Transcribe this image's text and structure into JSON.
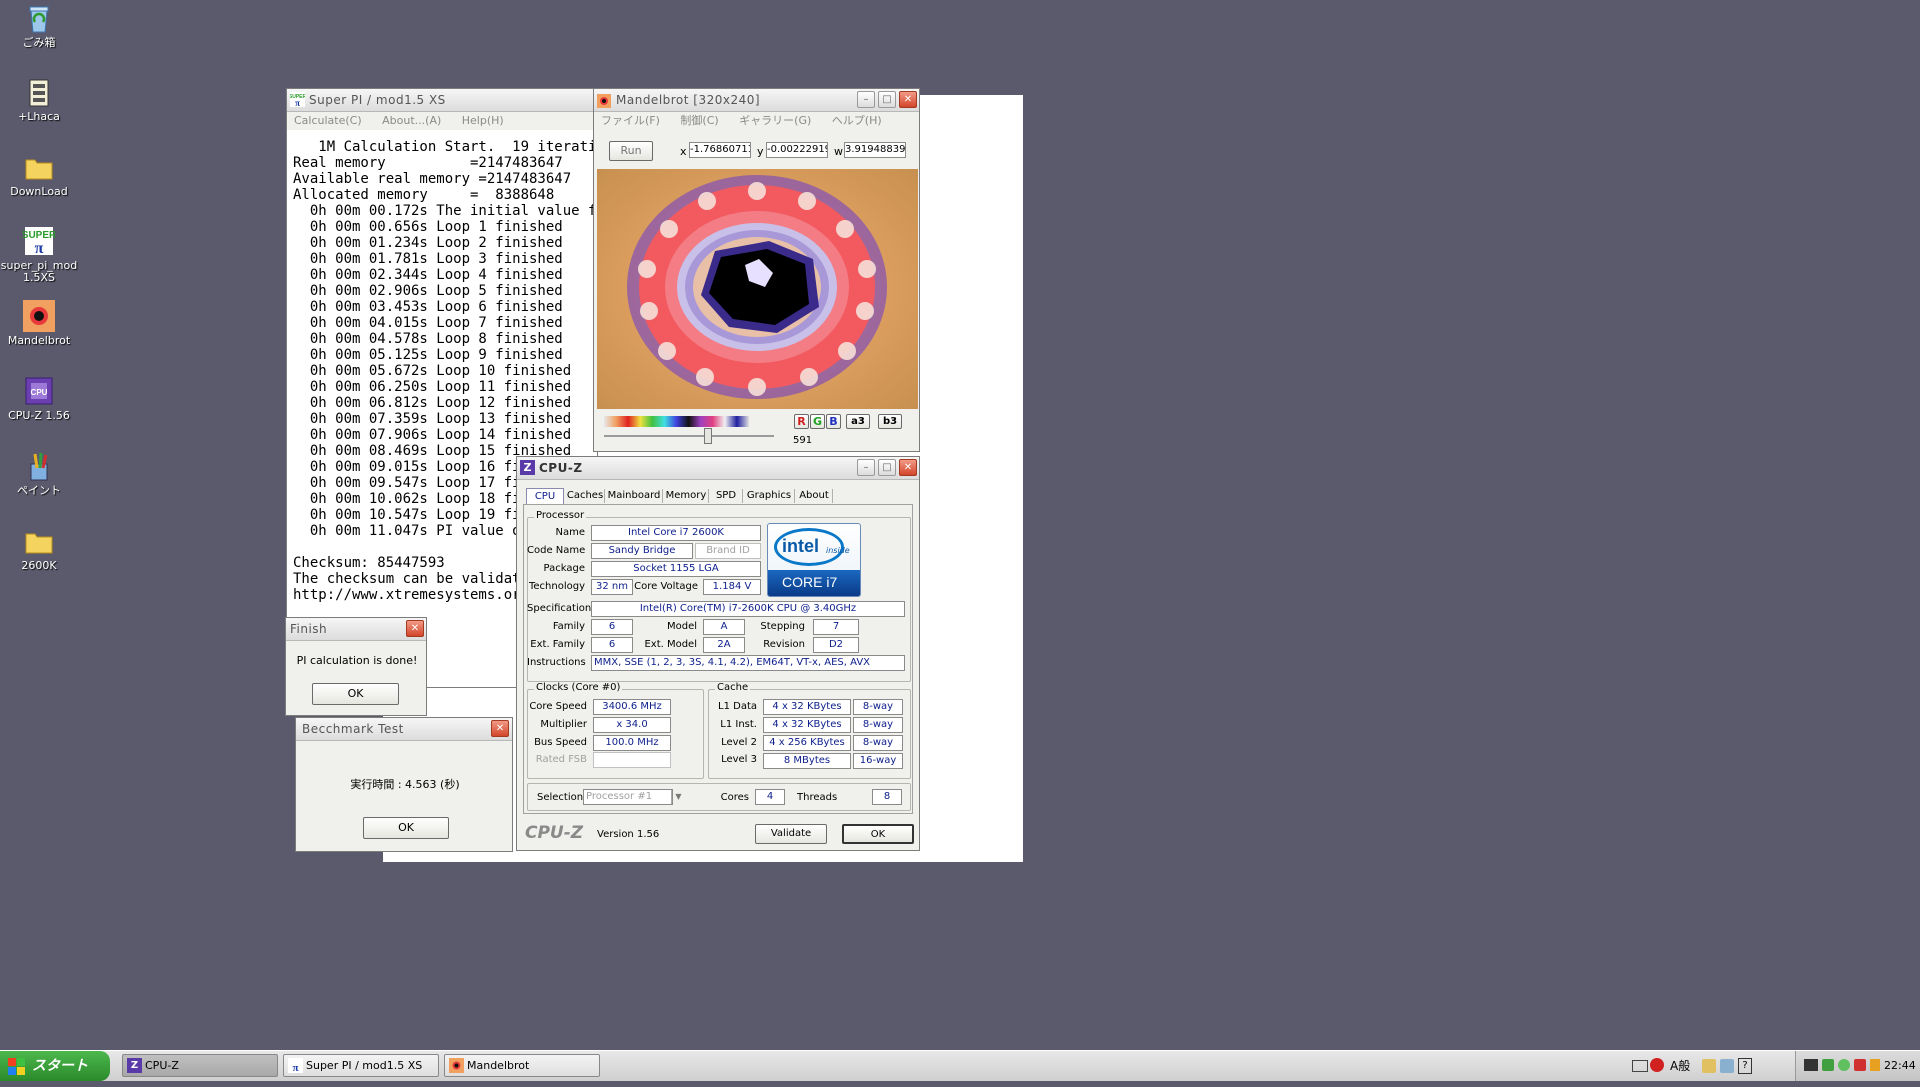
{
  "desktop": {
    "icons": [
      {
        "label": "ごみ箱",
        "name": "recycle-bin-icon"
      },
      {
        "label": "+Lhaca",
        "name": "lhaca-icon"
      },
      {
        "label": "DownLoad",
        "name": "folder-icon"
      },
      {
        "label": "super_pi_mod 1.5XS",
        "name": "superpi-app-icon"
      },
      {
        "label": "Mandelbrot",
        "name": "mandelbrot-app-icon"
      },
      {
        "label": "CPU-Z 1.56",
        "name": "cpuz-app-icon"
      },
      {
        "label": "ペイント",
        "name": "paint-app-icon"
      },
      {
        "label": "2600K",
        "name": "folder-icon"
      }
    ]
  },
  "superpi": {
    "title": "Super PI / mod1.5 XS",
    "menu": [
      "Calculate(C)",
      "About...(A)",
      "Help(H)"
    ],
    "log": [
      "   1M Calculation Start.  19 iterations.",
      "Real memory          =2147483647",
      "Available real memory =2147483647",
      "Allocated memory     =  8388648",
      "  0h 00m 00.172s The initial value finished",
      "  0h 00m 00.656s Loop 1 finished",
      "  0h 00m 01.234s Loop 2 finished",
      "  0h 00m 01.781s Loop 3 finished",
      "  0h 00m 02.344s Loop 4 finished",
      "  0h 00m 02.906s Loop 5 finished",
      "  0h 00m 03.453s Loop 6 finished",
      "  0h 00m 04.015s Loop 7 finished",
      "  0h 00m 04.578s Loop 8 finished",
      "  0h 00m 05.125s Loop 9 finished",
      "  0h 00m 05.672s Loop 10 finished",
      "  0h 00m 06.250s Loop 11 finished",
      "  0h 00m 06.812s Loop 12 finished",
      "  0h 00m 07.359s Loop 13 finished",
      "  0h 00m 07.906s Loop 14 finished",
      "  0h 00m 08.469s Loop 15 finished",
      "  0h 00m 09.015s Loop 16 finished",
      "  0h 00m 09.547s Loop 17 finished",
      "  0h 00m 10.062s Loop 18 finished",
      "  0h 00m 10.547s Loop 19 finished",
      "  0h 00m 11.047s PI value output -> pi_data.txt",
      "",
      "Checksum: 85447593",
      "The checksum can be validated at",
      "http://www.xtremesystems.org/"
    ]
  },
  "finish_dialog": {
    "title": "Finish",
    "message": "PI calculation is done!",
    "ok": "OK"
  },
  "bench_dialog": {
    "title": "Becchmark Test",
    "message": "実行時間 : 4.563 (秒)",
    "ok": "OK"
  },
  "mandelbrot": {
    "title": "Mandelbrot  [320x240]",
    "menu": [
      "ファイル(F)",
      "制御(C)",
      "ギャラリー(G)",
      "ヘルプ(H)"
    ],
    "run": "Run",
    "x_label": "x",
    "x_value": "-1.76860711",
    "y_label": "y",
    "y_value": "-0.00222919",
    "w_label": "w",
    "w_value": "3.91948839",
    "color_buttons": [
      "R",
      "G",
      "B",
      "a3",
      "b3"
    ],
    "slider_value": "591"
  },
  "cpuz": {
    "title": "CPU-Z",
    "tabs": [
      "CPU",
      "Caches",
      "Mainboard",
      "Memory",
      "SPD",
      "Graphics",
      "About"
    ],
    "processor_group": "Processor",
    "name_label": "Name",
    "name": "Intel Core i7 2600K",
    "codename_label": "Code Name",
    "codename": "Sandy Bridge",
    "brandid_label": "Brand ID",
    "package_label": "Package",
    "package": "Socket 1155 LGA",
    "technology_label": "Technology",
    "technology": "32 nm",
    "voltage_label": "Core Voltage",
    "voltage": "1.184 V",
    "spec_label": "Specification",
    "spec": "Intel(R) Core(TM) i7-2600K CPU @ 3.40GHz",
    "family_label": "Family",
    "family": "6",
    "model_label": "Model",
    "model": "A",
    "stepping_label": "Stepping",
    "stepping": "7",
    "extfamily_label": "Ext. Family",
    "extfamily": "6",
    "extmodel_label": "Ext. Model",
    "extmodel": "2A",
    "revision_label": "Revision",
    "revision": "D2",
    "instr_label": "Instructions",
    "instr": "MMX, SSE (1, 2, 3, 3S, 4.1, 4.2), EM64T, VT-x, AES, AVX",
    "logo": {
      "line1": "intel",
      "line2": "inside",
      "line3": "CORE i7"
    },
    "clocks_group": "Clocks (Core #0)",
    "corespeed_label": "Core Speed",
    "corespeed": "3400.6 MHz",
    "multiplier_label": "Multiplier",
    "multiplier": "x 34.0",
    "busspeed_label": "Bus Speed",
    "busspeed": "100.0 MHz",
    "ratedfsb_label": "Rated FSB",
    "cache_group": "Cache",
    "l1d_label": "L1 Data",
    "l1d": "4 x 32 KBytes",
    "l1d_way": "8-way",
    "l1i_label": "L1 Inst.",
    "l1i": "4 x 32 KBytes",
    "l1i_way": "8-way",
    "l2_label": "Level 2",
    "l2": "4 x 256 KBytes",
    "l2_way": "8-way",
    "l3_label": "Level 3",
    "l3": "8 MBytes",
    "l3_way": "16-way",
    "selection_label": "Selection",
    "selection": "Processor #1",
    "cores_label": "Cores",
    "cores": "4",
    "threads_label": "Threads",
    "threads": "8",
    "brand": "CPU-Z",
    "version": "Version 1.56",
    "validate": "Validate",
    "ok": "OK"
  },
  "taskbar": {
    "start": "スタート",
    "items": [
      "CPU-Z",
      "Super PI / mod1.5 XS",
      "Mandelbrot"
    ],
    "tray_ime": "A般",
    "clock": "22:44"
  }
}
